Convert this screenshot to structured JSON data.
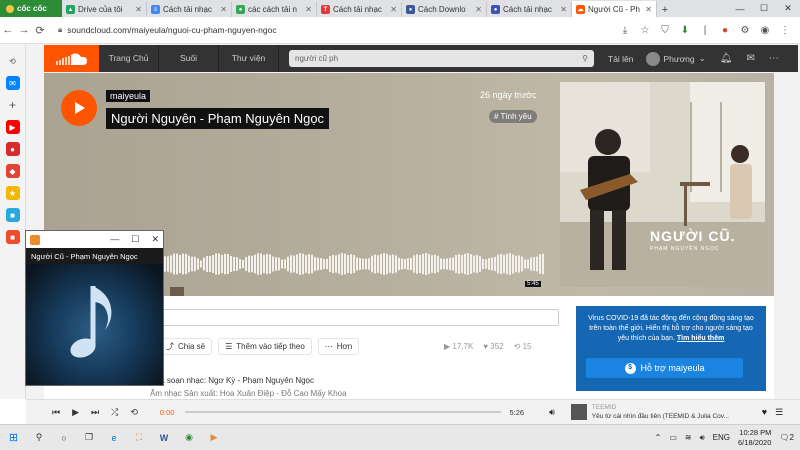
{
  "browser": {
    "brand": "cốc cốc",
    "tabs": [
      {
        "label": "Drive của tôi",
        "icon_color": "#1fa463"
      },
      {
        "label": "Cách tải nhạc",
        "icon_color": "#4285f4"
      },
      {
        "label": "các cách tải n",
        "icon_color": "#34a853"
      },
      {
        "label": "Cách tải nhạc",
        "icon_color": "#e53935"
      },
      {
        "label": "Cách Downlo",
        "icon_color": "#3b5998"
      },
      {
        "label": "Cách tải nhạc",
        "icon_color": "#3f51b5"
      },
      {
        "label": "Người Cũ - Ph",
        "icon_color": "#ff5500",
        "active": true
      }
    ],
    "url": "soundcloud.com/maiyeula/nguoi-cu-pham-nguyen-ngoc"
  },
  "soundcloud": {
    "nav": [
      "Trang Chủ",
      "Suối",
      "Thư viện"
    ],
    "search_value": "người cũ ph",
    "upload": "Tải lên",
    "user": "Phương",
    "track": {
      "uploader": "maiyeula",
      "title": "Người Nguyên - Phạm Nguyên Ngọc",
      "posted": "26 ngày trước",
      "tag": "# Tình yêu",
      "duration_marker": "5:45",
      "artwork_title": "NGƯỜI CŨ.",
      "artwork_sub": "PHẠM NGUYÊN NGỌC"
    },
    "actions": {
      "share": "Chia sẻ",
      "add_next": "Thêm vào tiếp theo",
      "more": "Hơn"
    },
    "stats": {
      "plays": "17,7K",
      "likes": "352",
      "reposts": "15"
    },
    "composer": "Nhà soạn nhạc: Ngơ Kỳ - Phạm Nguyên Ngọc",
    "composer2": "Ấm nhạc Sản xuất: Hoa Xuân Điệp - Đỗ Cao Mấy Khoa",
    "covid": {
      "text": "Virus COVID-19 đã tác động đến cộng đồng sáng tạo trên toàn thế giới. Hiển thị hỗ trợ cho người sáng tạo yêu thích của bạn.",
      "link": "Tìm hiểu thêm",
      "button": "Hỗ trợ maiyeula"
    },
    "player": {
      "elapsed": "0:00",
      "total": "5:26",
      "now_playing_artist": "TEEMID",
      "now_playing_title": "Yêu từ cái nhìn đầu tiên (TEEMID & Julia Cov..."
    }
  },
  "media_window": {
    "title": "Người Cũ - Phạm Nguyên Ngọc"
  },
  "taskbar": {
    "lang": "ENG",
    "time": "10:28 PM",
    "date": "6/18/2020",
    "notify": "2"
  }
}
